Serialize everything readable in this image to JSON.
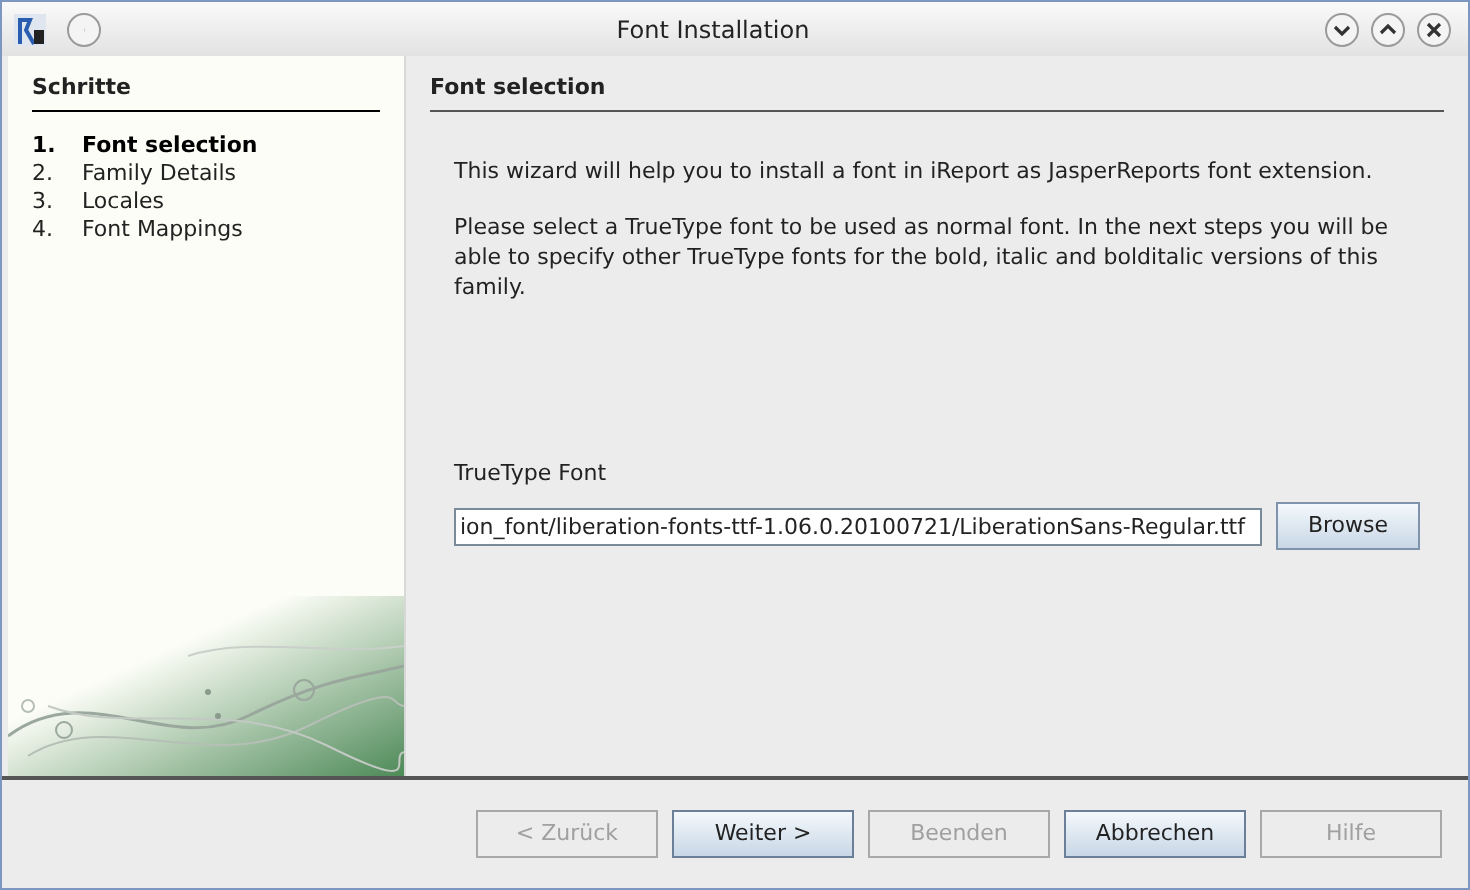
{
  "window": {
    "title": "Font Installation"
  },
  "sidebar": {
    "heading": "Schritte",
    "steps": [
      {
        "number": "1.",
        "label": "Font selection",
        "selected": true
      },
      {
        "number": "2.",
        "label": "Family Details",
        "selected": false
      },
      {
        "number": "3.",
        "label": "Locales",
        "selected": false
      },
      {
        "number": "4.",
        "label": "Font Mappings",
        "selected": false
      }
    ]
  },
  "panel": {
    "heading": "Font selection",
    "paragraphs": [
      "This wizard will help you to install a font in iReport as JasperReports font extension.",
      "Please select a TrueType font to be used as normal font. In the next steps you will be able to specify other TrueType fonts for the bold, italic and bolditalic versions of this family."
    ],
    "field_label": "TrueType Font",
    "field_value": "ion_font/liberation-fonts-ttf-1.06.0.20100721/LiberationSans-Regular.ttf",
    "browse": "Browse"
  },
  "buttons": [
    {
      "label": "< Zurück",
      "disabled": true
    },
    {
      "label": "Weiter >",
      "disabled": false
    },
    {
      "label": "Beenden",
      "disabled": true
    },
    {
      "label": "Abbrechen",
      "disabled": false
    },
    {
      "label": "Hilfe",
      "disabled": true
    }
  ]
}
